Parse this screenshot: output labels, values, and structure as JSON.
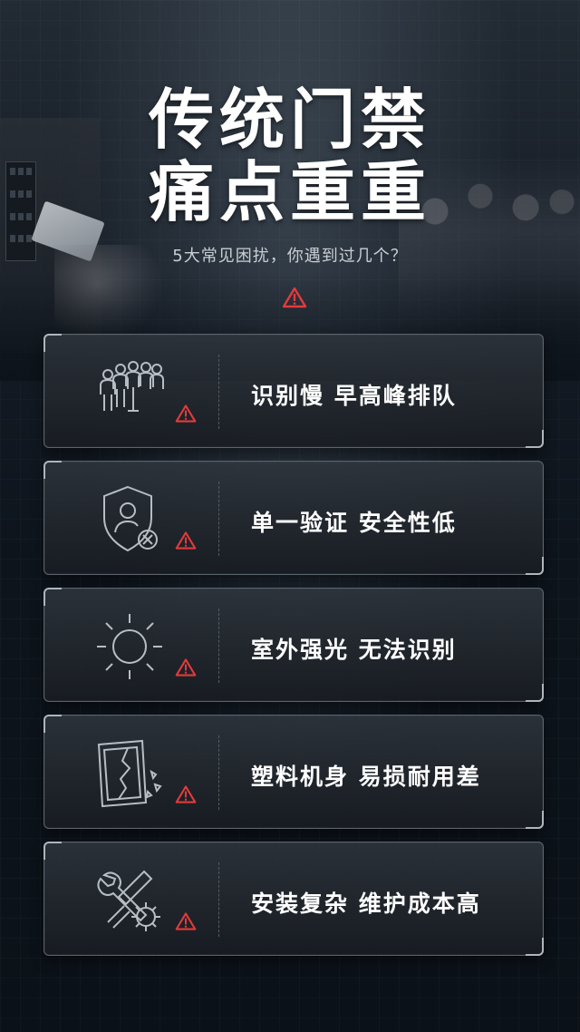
{
  "header": {
    "title_line1": "传统门禁",
    "title_line2": "痛点重重",
    "subtitle": "5大常见困扰，你遇到过几个？"
  },
  "colors": {
    "warning": "#e23b3b",
    "background": "#0c1219",
    "text": "#ffffff"
  },
  "items": [
    {
      "label": "识别慢 早高峰排队",
      "icon": "crowd-queue-icon"
    },
    {
      "label": "单一验证 安全性低",
      "icon": "shield-user-icon"
    },
    {
      "label": "室外强光 无法识别",
      "icon": "sun-icon"
    },
    {
      "label": "塑料机身 易损耐用差",
      "icon": "broken-panel-icon"
    },
    {
      "label": "安装复杂 维护成本高",
      "icon": "wrench-gear-icon"
    }
  ]
}
